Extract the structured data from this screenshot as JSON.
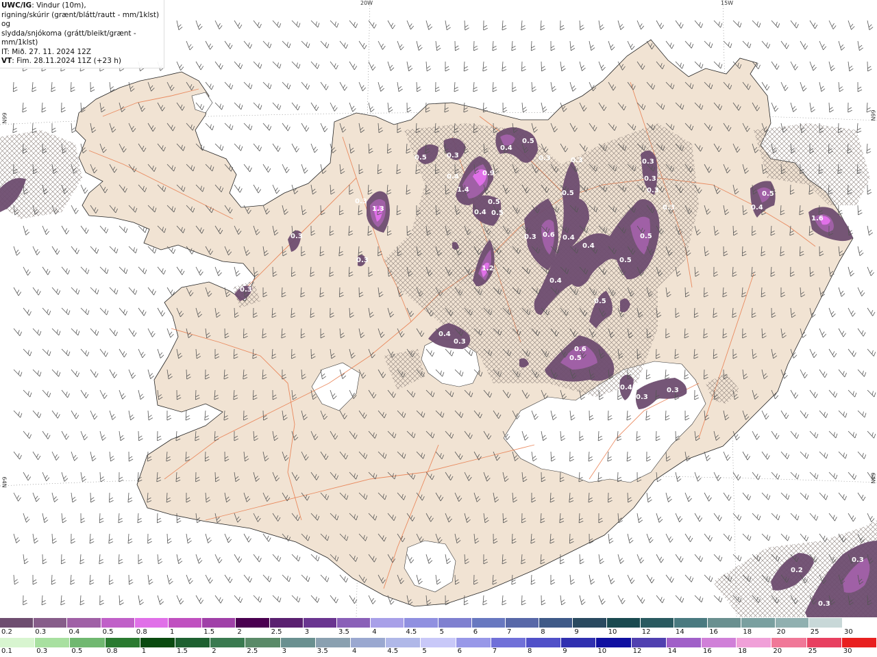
{
  "header": {
    "title_bold": "UWC/IG",
    "title_rest": ": Vindur (10m),",
    "line2": "rigning/skúrir (grænt/blátt/rautt - mm/1klst) og",
    "line3": "slydda/snjókoma (grátt/bleikt/grænt - mm/1klst)",
    "line4": "IT: Mið. 27. 11. 2024 12Z",
    "line5_bold": "VT",
    "line5_rest": ": Fim. 28.11.2024 11Z (+23 h)"
  },
  "grid_labels": {
    "lon_20w": "20W",
    "lon_15w": "15W",
    "lat_66n_left": "66N",
    "lat_66n_right": "66N",
    "lat_64n_left": "64N",
    "lat_64n_right": "64N"
  },
  "precip_values": [
    {
      "id": "p1",
      "text": "0.5"
    },
    {
      "id": "p2",
      "text": "0.3"
    },
    {
      "id": "p3",
      "text": "0.4"
    },
    {
      "id": "p4",
      "text": "1.4"
    },
    {
      "id": "p5",
      "text": "0.9"
    },
    {
      "id": "p6",
      "text": "0.5"
    },
    {
      "id": "p7",
      "text": "0.4"
    },
    {
      "id": "p8",
      "text": "0.5"
    },
    {
      "id": "p9",
      "text": "0.4"
    },
    {
      "id": "p10",
      "text": "0.5"
    },
    {
      "id": "p11",
      "text": "0.3"
    },
    {
      "id": "p12",
      "text": "1.3"
    },
    {
      "id": "p13",
      "text": "0.3"
    },
    {
      "id": "p14",
      "text": "0.3"
    },
    {
      "id": "p15",
      "text": "1.2"
    },
    {
      "id": "p16",
      "text": "0.3"
    },
    {
      "id": "p17",
      "text": "0.3"
    },
    {
      "id": "p18",
      "text": "0.3"
    },
    {
      "id": "p19",
      "text": "0.6"
    },
    {
      "id": "p20",
      "text": "0.4"
    },
    {
      "id": "p21",
      "text": "0.5"
    },
    {
      "id": "p22",
      "text": "0.4"
    },
    {
      "id": "p23",
      "text": "0.3"
    },
    {
      "id": "p24",
      "text": "0.3"
    },
    {
      "id": "p25",
      "text": "0.3"
    },
    {
      "id": "p26",
      "text": "0.5"
    },
    {
      "id": "p27",
      "text": "0.5"
    },
    {
      "id": "p28",
      "text": "0.3"
    },
    {
      "id": "p29",
      "text": "0.5"
    },
    {
      "id": "p30",
      "text": "0.4"
    },
    {
      "id": "p31",
      "text": "1.6"
    },
    {
      "id": "p32",
      "text": "0.4"
    },
    {
      "id": "p33",
      "text": "0.3"
    },
    {
      "id": "p34",
      "text": "0.6"
    },
    {
      "id": "p35",
      "text": "0.5"
    },
    {
      "id": "p36",
      "text": "0.4"
    },
    {
      "id": "p37",
      "text": "0.4"
    },
    {
      "id": "p38",
      "text": "0.3"
    },
    {
      "id": "p39",
      "text": "0.3"
    },
    {
      "id": "p40",
      "text": "0.2"
    },
    {
      "id": "p41",
      "text": "0.3"
    },
    {
      "id": "p42",
      "text": "0.3"
    },
    {
      "id": "p43",
      "text": "0.5"
    },
    {
      "id": "p44",
      "text": "0.3"
    }
  ],
  "legend_snow": {
    "labels": [
      "0.2",
      "0.3",
      "0.4",
      "0.5",
      "0.8",
      "1",
      "1.5",
      "2",
      "2.5",
      "3",
      "3.5",
      "4",
      "4.5",
      "5",
      "6",
      "7",
      "8",
      "9",
      "10",
      "12",
      "14",
      "16",
      "18",
      "20",
      "25",
      "30"
    ],
    "colors": [
      "#6e4d70",
      "#875d8a",
      "#a060a6",
      "#c060c8",
      "#e070e8",
      "#c050c0",
      "#a040a8",
      "#4a0050",
      "#5a2070",
      "#6a3590",
      "#8a60b8",
      "#a8a0e8",
      "#9090e0",
      "#7f80d0",
      "#6878c0",
      "#5868a8",
      "#3f5a88",
      "#2a4a60",
      "#1a4a50",
      "#2a5a60",
      "#4a7a80",
      "#6a9090",
      "#7aa0a0",
      "#90b0b0",
      "#c8d8d8",
      "#ffffff"
    ]
  },
  "legend_rain": {
    "labels": [
      "0.1",
      "0.3",
      "0.5",
      "0.8",
      "1",
      "1.5",
      "2",
      "2.5",
      "3",
      "3.5",
      "4",
      "4.5",
      "5",
      "6",
      "7",
      "8",
      "9",
      "10",
      "12",
      "14",
      "16",
      "18",
      "20",
      "25",
      "30"
    ],
    "colors": [
      "#d8f5d0",
      "#a8e0a0",
      "#70b870",
      "#2a7a30",
      "#0a4a10",
      "#1e6030",
      "#3a7a50",
      "#5a8a68",
      "#6a9090",
      "#8aa0b0",
      "#9aa8d0",
      "#b0b8e8",
      "#c8c8f8",
      "#9898e8",
      "#7070d8",
      "#5050c8",
      "#3030b0",
      "#1010a0",
      "#5040b0",
      "#a060c8",
      "#d080d8",
      "#f0a0d8",
      "#f07898",
      "#e84060",
      "#e82020"
    ]
  }
}
